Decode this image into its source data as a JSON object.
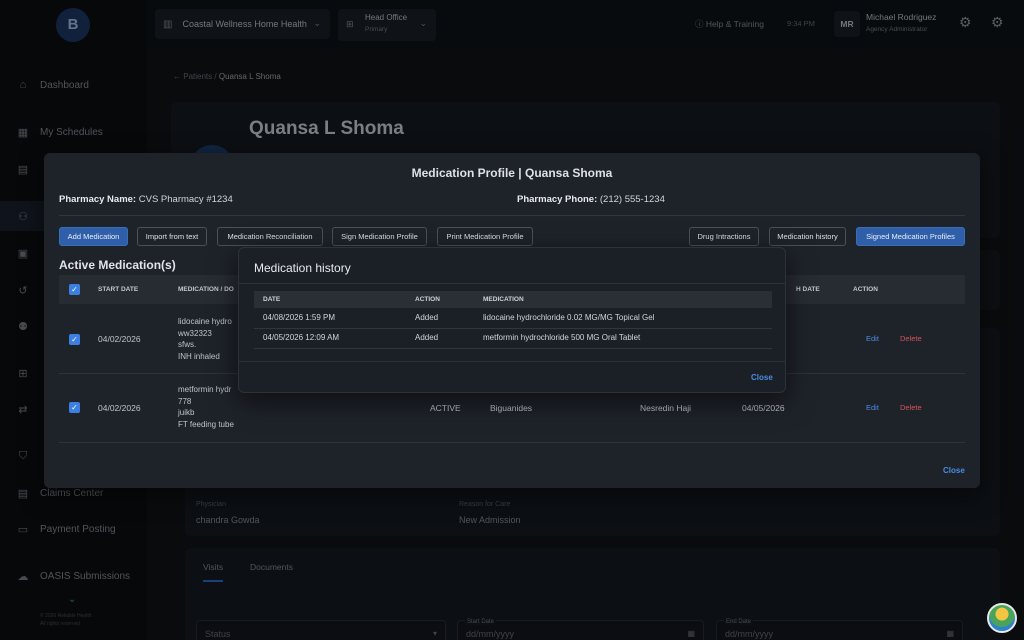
{
  "topbar": {
    "org": "Coastal Wellness Home Health",
    "office_name": "Head Office",
    "office_sub": "Primary",
    "help": "Help & Training",
    "time": "9:34 PM",
    "avatar": "MR",
    "user_name": "Michael Rodriguez",
    "user_role": "Agency Administrator"
  },
  "sidebar": {
    "logo": "B",
    "items": [
      {
        "label": "Dashboard",
        "icon": "home-icon"
      },
      {
        "label": "My Schedules",
        "icon": "calendar-icon"
      },
      {
        "label": "Claims Center",
        "icon": "document-icon"
      },
      {
        "label": "Payment Posting",
        "icon": "card-icon"
      },
      {
        "label": "OASIS Submissions",
        "icon": "cloud-upload-icon"
      }
    ],
    "footer1": "© 2026 Reliable Health",
    "footer2": "All rights reserved"
  },
  "breadcrumb": {
    "parent": "Patients",
    "current": "Quansa L Shoma"
  },
  "patient": {
    "name": "Quansa L Shoma",
    "physician_label": "Physician",
    "physician": "chandra Gowda",
    "reason_label": "Reason for Care",
    "reason": "New Admission"
  },
  "tabs": [
    "Visits",
    "Documents"
  ],
  "filters": {
    "status_placeholder": "Status",
    "start_label": "Start Date",
    "end_label": "End Date",
    "date_placeholder": "dd/mm/yyyy"
  },
  "med_profile": {
    "title": "Medication Profile | Quansa Shoma",
    "pharmacy_name_label": "Pharmacy Name:",
    "pharmacy_name": "CVS Pharmacy #1234",
    "pharmacy_phone_label": "Pharmacy Phone:",
    "pharmacy_phone": "(212) 555-1234",
    "buttons": {
      "add": "Add Medication",
      "import": "Import from text",
      "reconcile": "Medication Reconciliation",
      "sign": "Sign Medication Profile",
      "print": "Print Medication Profile",
      "drug": "Drug Intractions",
      "history": "Medication history",
      "signed": "Signed Medication Profiles"
    },
    "active_title": "Active Medication(s)",
    "columns": {
      "start": "START DATE",
      "med": "MEDICATION / DO",
      "end": "H DATE",
      "action": "ACTION"
    },
    "rows": [
      {
        "start": "04/02/2026",
        "lines": [
          "lidocaine hydro",
          "ww32323",
          "sfws.",
          "INH inhaled"
        ],
        "end": "",
        "edit": "Edit",
        "delete": "Delete"
      },
      {
        "start": "04/02/2026",
        "lines": [
          "metformin hydr",
          "778",
          "juikb",
          "FT feeding tube"
        ],
        "status": "ACTIVE",
        "class": "Biguanides",
        "provider": "Nesredin Haji",
        "end": "04/05/2026",
        "edit": "Edit",
        "delete": "Delete"
      }
    ],
    "close": "Close"
  },
  "med_history": {
    "title": "Medication history",
    "columns": {
      "date": "DATE",
      "action": "ACTION",
      "medication": "MEDICATION"
    },
    "rows": [
      {
        "date": "04/08/2026 1:59 PM",
        "action": "Added",
        "medication": "lidocaine hydrochloride 0.02 MG/MG Topical Gel"
      },
      {
        "date": "04/05/2026 12:09 AM",
        "action": "Added",
        "medication": "metformin hydrochloride 500 MG Oral Tablet"
      }
    ],
    "close": "Close"
  }
}
